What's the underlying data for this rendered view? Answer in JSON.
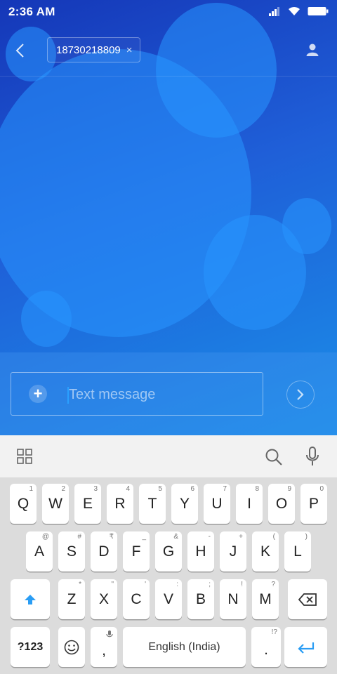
{
  "status_bar": {
    "time": "2:36 AM",
    "icons": [
      "signal-icon",
      "wifi-icon",
      "battery-icon"
    ]
  },
  "header": {
    "recipient": "18730218809",
    "remove_symbol": "×"
  },
  "compose": {
    "placeholder": "Text message",
    "add_symbol": "+"
  },
  "keyboard": {
    "row1": [
      {
        "label": "Q",
        "hint": "1"
      },
      {
        "label": "W",
        "hint": "2"
      },
      {
        "label": "E",
        "hint": "3"
      },
      {
        "label": "R",
        "hint": "4"
      },
      {
        "label": "T",
        "hint": "5"
      },
      {
        "label": "Y",
        "hint": "6"
      },
      {
        "label": "U",
        "hint": "7"
      },
      {
        "label": "I",
        "hint": "8"
      },
      {
        "label": "O",
        "hint": "9"
      },
      {
        "label": "P",
        "hint": "0"
      }
    ],
    "row2": [
      {
        "label": "A",
        "hint": "@"
      },
      {
        "label": "S",
        "hint": "#"
      },
      {
        "label": "D",
        "hint": "₹"
      },
      {
        "label": "F",
        "hint": "_"
      },
      {
        "label": "G",
        "hint": "&"
      },
      {
        "label": "H",
        "hint": "-"
      },
      {
        "label": "J",
        "hint": "+"
      },
      {
        "label": "K",
        "hint": "("
      },
      {
        "label": "L",
        "hint": ")"
      }
    ],
    "row3": [
      {
        "label": "Z",
        "hint": "*"
      },
      {
        "label": "X",
        "hint": "\""
      },
      {
        "label": "C",
        "hint": "'"
      },
      {
        "label": "V",
        "hint": ":"
      },
      {
        "label": "B",
        "hint": ";"
      },
      {
        "label": "N",
        "hint": "!"
      },
      {
        "label": "M",
        "hint": "?"
      }
    ],
    "symbols_label": "?123",
    "comma_label": ",",
    "space_label": "English (India)",
    "period_label": ".",
    "period_hint": "!?"
  },
  "colors": {
    "accent": "#2a9df4"
  }
}
